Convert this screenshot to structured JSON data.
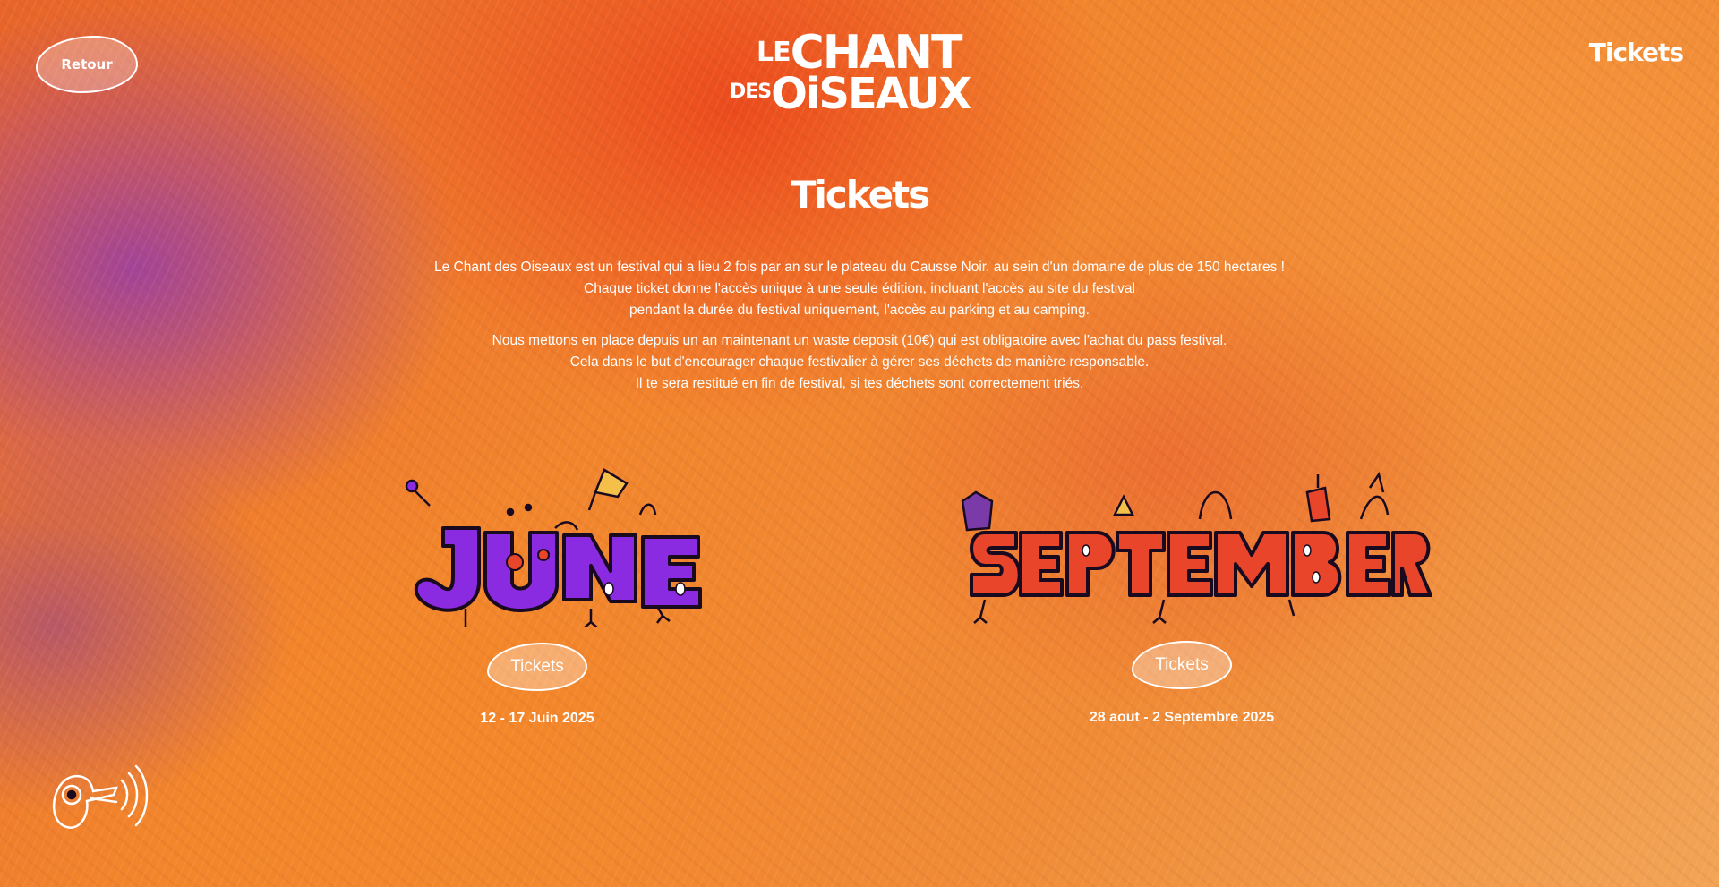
{
  "header": {
    "back_label": "Retour",
    "logo": {
      "line1_small": "LE",
      "line1_big": "CHANT",
      "line2_small": "DES",
      "line2_big": "OiSEAUX"
    },
    "tickets_link": "Tickets"
  },
  "main": {
    "title": "Tickets",
    "description": {
      "para1": [
        "Le Chant des Oiseaux est un festival qui a lieu 2 fois par an sur le plateau du Causse Noir, au sein d'un domaine de plus de 150 hectares !",
        "Chaque ticket donne l'accès unique à une seule édition, incluant l'accès au site du festival",
        "pendant la durée du festival uniquement, l'accès au parking et au camping."
      ],
      "para2": [
        "Nous mettons en place depuis un an maintenant un waste deposit (10€) qui est obligatoire avec l'achat du pass festival.",
        "Cela dans le but d'encourager chaque festivalier à gérer ses déchets de manière responsable.",
        "Il te sera restitué en fin de festival, si tes déchets sont correctement triés."
      ]
    },
    "editions": [
      {
        "word": "JUNE",
        "word_color": "#8a2be2",
        "button_label": "Tickets",
        "dates": "12 - 17 Juin 2025"
      },
      {
        "word": "SEPTEMBER",
        "word_color": "#e8452a",
        "button_label": "Tickets",
        "dates": "28 aout - 2 Septembre 2025"
      }
    ]
  },
  "icons": {
    "sound_toggle": "speaker-eye-icon"
  },
  "colors": {
    "text": "#ffffff",
    "june_purple": "#8a2be2",
    "september_red": "#e8452a"
  }
}
